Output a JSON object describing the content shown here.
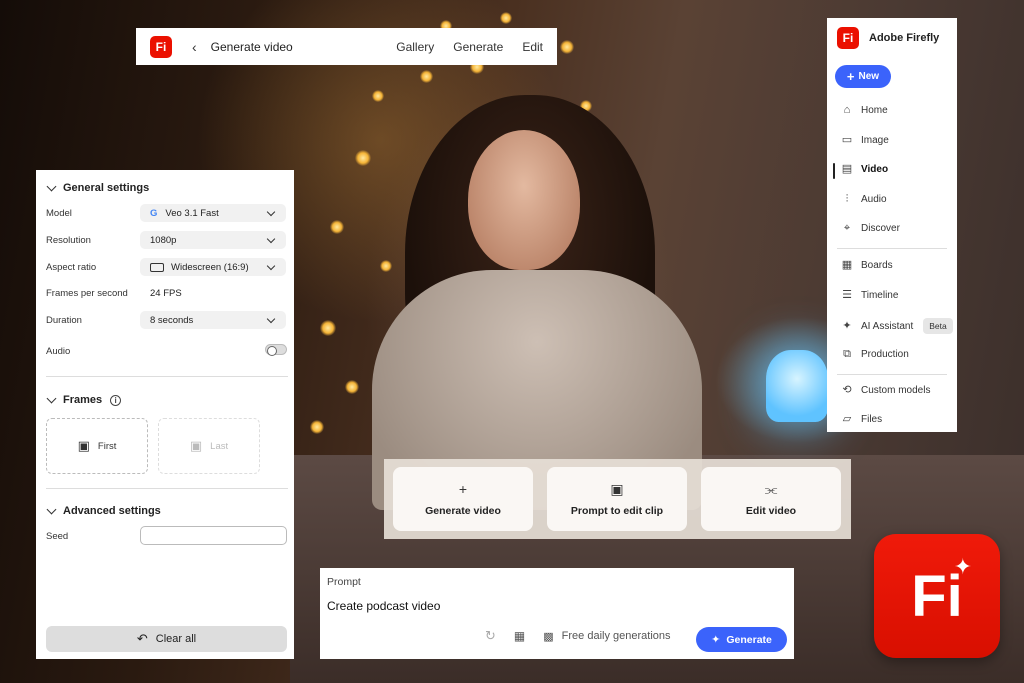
{
  "top_bar": {
    "logo_text": "Fi",
    "back_icon": "chevron-left-icon",
    "title": "Generate video",
    "nav": [
      "Gallery",
      "Generate",
      "Edit"
    ]
  },
  "settings": {
    "general_title": "General settings",
    "model_label": "Model",
    "model_value": "Veo 3.1 Fast",
    "model_icon": "G",
    "resolution_label": "Resolution",
    "resolution_value": "1080p",
    "aspect_label": "Aspect ratio",
    "aspect_value": "Widescreen (16:9)",
    "fps_label": "Frames per second",
    "fps_value": "24 FPS",
    "duration_label": "Duration",
    "duration_value": "8 seconds",
    "audio_label": "Audio",
    "audio_on": false,
    "frames_title": "Frames",
    "frame_first": "First",
    "frame_last": "Last",
    "advanced_title": "Advanced settings",
    "seed_label": "Seed",
    "seed_value": "",
    "clear_label": "Clear all"
  },
  "sidebar": {
    "brand": "Adobe Firefly",
    "logo_text": "Fi",
    "new_label": "New",
    "items": [
      {
        "label": "Home",
        "icon": "home-icon",
        "glyph": "⌂"
      },
      {
        "label": "Image",
        "icon": "image-icon",
        "glyph": "▭"
      },
      {
        "label": "Video",
        "icon": "video-icon",
        "glyph": "▤"
      },
      {
        "label": "Audio",
        "icon": "audio-icon",
        "glyph": "⫶"
      },
      {
        "label": "Discover",
        "icon": "discover-icon",
        "glyph": "⌖"
      },
      {
        "label": "Boards",
        "icon": "boards-icon",
        "glyph": "▦"
      },
      {
        "label": "Timeline",
        "icon": "timeline-icon",
        "glyph": "☰"
      },
      {
        "label": "AI Assistant",
        "icon": "ai-assistant-icon",
        "glyph": "✦"
      },
      {
        "label": "Production",
        "icon": "production-icon",
        "glyph": "⧉"
      },
      {
        "label": "Custom models",
        "icon": "custom-models-icon",
        "glyph": "⟲"
      },
      {
        "label": "Files",
        "icon": "files-icon",
        "glyph": "▱"
      }
    ],
    "beta_label": "Beta"
  },
  "actions": [
    {
      "label": "Generate video",
      "glyph": "+"
    },
    {
      "label": "Prompt to edit clip",
      "glyph": "▣"
    },
    {
      "label": "Edit video",
      "glyph": "⫘"
    }
  ],
  "prompt": {
    "label": "Prompt",
    "text": "Create podcast video",
    "free_label": "Free daily generations",
    "generate_label": "Generate"
  },
  "brand_logo": "Fi",
  "colors": {
    "accent": "#3b63fb",
    "brand": "#eb1000"
  }
}
